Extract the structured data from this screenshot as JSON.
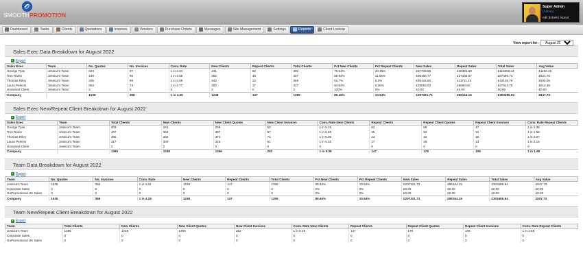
{
  "app": {
    "logo_text_a": "SMOOTH",
    "logo_text_b": "PROMOTION",
    "user": {
      "name": "Super Admin",
      "role": "(Admin)",
      "edit": "edit details",
      "logout": "logout"
    }
  },
  "nav": [
    {
      "label": "Dashboard",
      "icon": "dashboard-icon",
      "color": "#6a6a6a"
    },
    {
      "label": "Tasks",
      "icon": "tasks-icon",
      "color": "#7a7a7a"
    },
    {
      "label": "Clients",
      "icon": "clients-icon",
      "color": "#8a6a4a"
    },
    {
      "label": "Quotations",
      "icon": "quotations-icon",
      "color": "#6a7a9a"
    },
    {
      "label": "Invoices",
      "icon": "invoices-icon",
      "color": "#5a7aa0"
    },
    {
      "label": "Vendors",
      "icon": "vendors-icon",
      "color": "#8a8a8a"
    },
    {
      "label": "Purchase Orders",
      "icon": "purchase-orders-icon",
      "color": "#7a7a7a"
    },
    {
      "label": "Messages",
      "icon": "messages-icon",
      "color": "#6a6a6a"
    },
    {
      "label": "Site Management",
      "icon": "site-management-icon",
      "color": "#7a7a7a"
    },
    {
      "label": "Settings",
      "icon": "settings-icon",
      "color": "#777"
    },
    {
      "label": "Reports",
      "icon": "reports-icon",
      "color": "#a8c8ff",
      "active": true
    },
    {
      "label": "Client Lookup",
      "icon": "client-lookup-icon",
      "color": "#7a7a7a"
    }
  ],
  "report_for": {
    "label": "View report for:",
    "selected": "August 2022"
  },
  "export_label": "Export",
  "sections": [
    {
      "title": "Sales Exec Data Breakdown for August 2022",
      "headers": [
        "Sales Exec",
        "Team",
        "No. Quotes",
        "No. Invoices",
        "Conv. Rate",
        "New Clients",
        "Repeat Clients",
        "Total Clients",
        "Pct New Clients",
        "Pct Repeat Clients",
        "New Sales",
        "Repeat Sales",
        "Total Sales",
        "Avg Value"
      ],
      "rows": [
        [
          "George Tyas",
          "Jessica's Team",
          "324",
          "97",
          "1 in 3.34",
          "241",
          "62",
          "303",
          "79.54%",
          "20.46%",
          "£67703.50",
          "£48365.89",
          "£116069.44",
          "£1196.49"
        ],
        [
          "Tom Rainn",
          "Jessica's Team",
          "448",
          "95",
          "1 in 4.58",
          "362",
          "45",
          "407",
          "88.94%",
          "11.06%",
          "£60160.77",
          "£27336.97",
          "£87496.74",
          "£921.70"
        ],
        [
          "Thomas Riley",
          "Jessica's Team",
          "405",
          "89",
          "1 in 4.55",
          "342",
          "23",
          "365",
          "93.7%",
          "6.3%",
          "£30415.60",
          "£11711.15",
          "£42126.78",
          "£690.05"
        ],
        [
          "Laura Perkins",
          "Jessica's Team",
          "353",
          "74",
          "1 in 4.77",
          "300",
          "17",
          "317",
          "94.64%",
          "5.36%",
          "£29053.83",
          "£8660.92",
          "£37913.75",
          "£512.35"
        ],
        [
          "Unowned Client",
          "Jessica's Team",
          "4",
          "0",
          "0",
          "2",
          "0",
          "2",
          "100%",
          "0%",
          "£0.00",
          "£0.00",
          "£0.00",
          "£0.00"
        ]
      ],
      "total": [
        "Company",
        "",
        "1535",
        "358",
        "1 in 4.29",
        "1248",
        "147",
        "1395",
        "89.46%",
        "10.54%",
        "£207321.73",
        "£96164.15",
        "£303485.94",
        "£847.73"
      ]
    },
    {
      "title": "Sales Exec New/Repeat Client Breakdown for August 2022",
      "headers": [
        "Sales Exec",
        "Team",
        "Total Clients",
        "New Clients",
        "New Client Quotes",
        "New Client Invoices",
        "Conv. Rate New Clients",
        "Repeat Clients",
        "Repeat Client Quotes",
        "Repeat Client Invoices",
        "Conv. Rate Repeat Clients"
      ],
      "rows": [
        [
          "George Tyas",
          "Jessica's Team",
          "303",
          "241",
          "258",
          "50",
          "1 in 5.16",
          "62",
          "66",
          "47",
          "1 in 1.38"
        ],
        [
          "Tom Rainn",
          "Jessica's Team",
          "407",
          "362",
          "397",
          "67",
          "1 in 5.93",
          "45",
          "52",
          "31",
          "1 in 1.58"
        ],
        [
          "Thomas Riley",
          "Jessica's Team",
          "365",
          "342",
          "374",
          "74",
          "1 in 5.05",
          "23",
          "31",
          "15",
          "1 in 2.07"
        ],
        [
          "Laura Perkins",
          "Jessica's Team",
          "317",
          "300",
          "325",
          "61",
          "1 in 5.33",
          "17",
          "29",
          "13",
          "1 in 2.15"
        ],
        [
          "Unowned Client",
          "Jessica's Team",
          "2",
          "2",
          "3",
          "0",
          "0",
          "0",
          "0",
          "0",
          "0"
        ]
      ],
      "total": [
        "Company",
        "",
        "1395",
        "1248",
        "1359",
        "252",
        "1 in 5.39",
        "147",
        "178",
        "106",
        "1 in 1.68"
      ]
    },
    {
      "title": "Team Data Breakdown for August 2022",
      "headers": [
        "Team",
        "No. Quotes",
        "No. Invoices",
        "Conv. Rate",
        "New Clients",
        "Repeat Clients",
        "Total Clients",
        "Pct New Clients",
        "Pct Repeat Clients",
        "New Sales",
        "Repeat Sales",
        "Total Sales",
        "Avg Value"
      ],
      "rows": [
        [
          "Jessica's Team",
          "1535",
          "358",
          "1 in 4.29",
          "1248",
          "147",
          "1395",
          "89.46%",
          "10.54%",
          "£207321.73",
          "£96164.15",
          "£303485.94",
          "£847.73"
        ],
        [
          "Corporate Sales",
          "0",
          "0",
          "0",
          "0",
          "0",
          "0",
          "0%",
          "0%",
          "£0.00",
          "£0.00",
          "£0.00",
          "£0.00"
        ],
        [
          "GoPromotional UK Sales",
          "0",
          "0",
          "0",
          "0",
          "0",
          "0",
          "0%",
          "0%",
          "£0.00",
          "£0.00",
          "£0.00",
          "£0.00"
        ]
      ],
      "total": [
        "Company",
        "1535",
        "358",
        "1 in 4.29",
        "1248",
        "147",
        "1395",
        "89.46%",
        "10.54%",
        "£207321.73",
        "£96164.15",
        "£303485.94",
        "£847.73"
      ]
    },
    {
      "title": "Team New/Repeat Client Breakdown for August 2022",
      "headers": [
        "Team",
        "Total Clients",
        "New Clients",
        "New Client Quotes",
        "New Client Invoices",
        "Conv. Rate New Clients",
        "Repeat Clients",
        "Repeat Client Quotes",
        "Repeat Client Invoices",
        "Conv. Rate Repeat Clients"
      ],
      "rows": [
        [
          "Jessica's Team",
          "1395",
          "1248",
          "1359",
          "252",
          "1 in 5.39",
          "147",
          "178",
          "106",
          "1 in 1.68"
        ],
        [
          "Corporate Sales",
          "0",
          "0",
          "0",
          "0",
          "0",
          "0",
          "0",
          "0",
          "0"
        ],
        [
          "GoPromotional UK Sales",
          "0",
          "0",
          "0",
          "0",
          "0",
          "0",
          "0",
          "0",
          "0"
        ]
      ],
      "total": null
    }
  ]
}
